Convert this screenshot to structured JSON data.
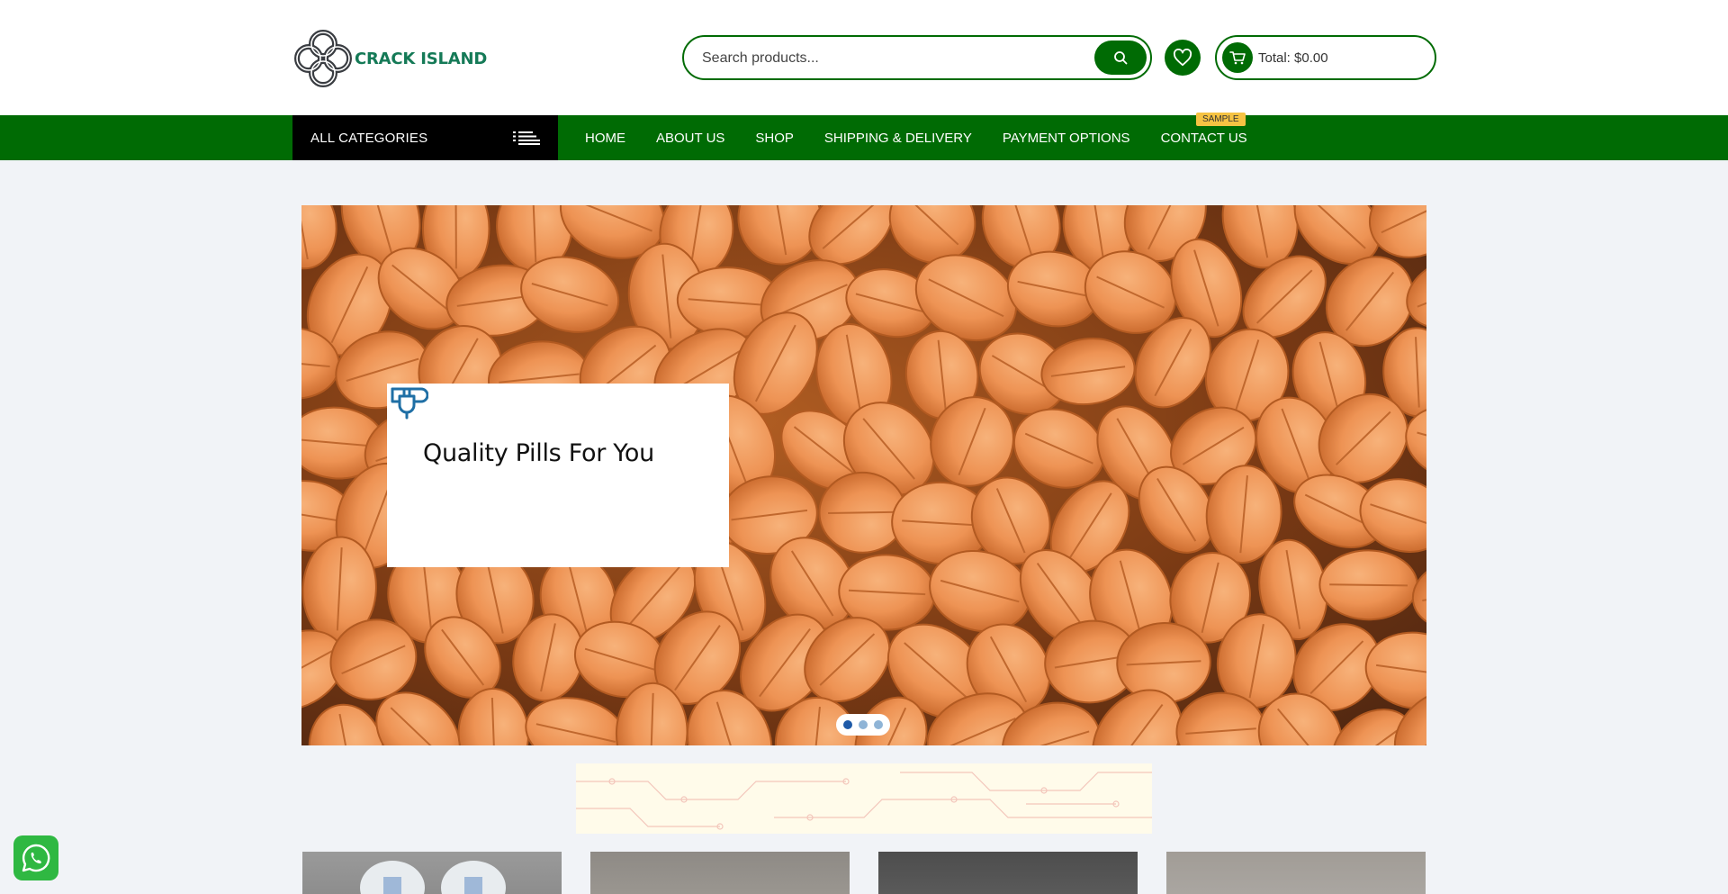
{
  "brand": {
    "name": "CRACK ISLAND",
    "color": "#157a57"
  },
  "search": {
    "placeholder": "Search products...",
    "value": "",
    "button_icon": "search-icon"
  },
  "wishlist": {
    "icon": "heart-icon"
  },
  "cart": {
    "icon": "cart-icon",
    "total_label": "Total: $0.00"
  },
  "nav": {
    "categories_label": "ALL CATEGORIES",
    "categories_icon": "hamburger-menu-icon",
    "items": [
      {
        "label": "HOME"
      },
      {
        "label": "ABOUT US"
      },
      {
        "label": "SHOP"
      },
      {
        "label": "SHIPPING & DELIVERY"
      },
      {
        "label": "PAYMENT OPTIONS"
      },
      {
        "label": "CONTACT US"
      }
    ],
    "badge": "SAMPLE"
  },
  "hero": {
    "title": "Quality Pills For You",
    "icon": "plug-icon",
    "slides_count": 3,
    "active_slide": 1
  },
  "chat": {
    "icon": "whatsapp-icon"
  },
  "colors": {
    "primary": "#006b04",
    "nav_dark": "#000000",
    "badge": "#f6c343",
    "background": "#f1f3f7"
  }
}
